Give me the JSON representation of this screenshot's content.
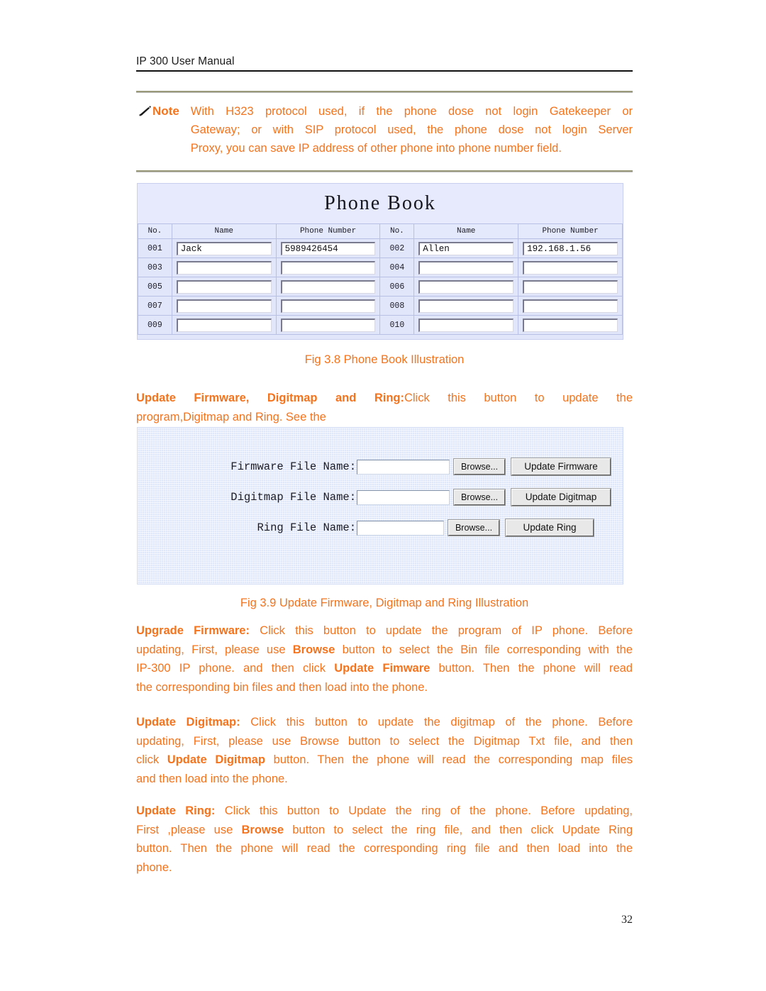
{
  "header": {
    "running_title": "IP 300 User Manual"
  },
  "note": {
    "icon": "pencil-icon",
    "label": "Note",
    "line1": "With H323 protocol used, if the phone dose not login Gatekeeper or",
    "line2": "Gateway; or with SIP protocol used, the phone dose not login Server",
    "line3": "Proxy, you can save IP address of other phone into phone number field.",
    "color": "#f4731c"
  },
  "phone_book": {
    "title": "Phone Book",
    "columns": [
      "No.",
      "Name",
      "Phone Number",
      "No.",
      "Name",
      "Phone Number"
    ],
    "rows": [
      {
        "no_left": "001",
        "name_left": "Jack",
        "phone_left": "5989426454",
        "no_right": "002",
        "name_right": "Allen",
        "phone_right": "192.168.1.56"
      },
      {
        "no_left": "003",
        "name_left": "",
        "phone_left": "",
        "no_right": "004",
        "name_right": "",
        "phone_right": ""
      },
      {
        "no_left": "005",
        "name_left": "",
        "phone_left": "",
        "no_right": "006",
        "name_right": "",
        "phone_right": ""
      },
      {
        "no_left": "007",
        "name_left": "",
        "phone_left": "",
        "no_right": "008",
        "name_right": "",
        "phone_right": ""
      },
      {
        "no_left": "009",
        "name_left": "",
        "phone_left": "",
        "no_right": "010",
        "name_right": "",
        "phone_right": ""
      }
    ],
    "background": "#e2e6fb"
  },
  "caption_38": "Fig 3.8 Phone Book Illustration",
  "caption_39": "Fig 3.9 Update Firmware, Digitmap and Ring Illustration",
  "intro_para": {
    "bold_lead": "Update Firmware, Digitmap and Ring:",
    "line1_rest": "Click this button to update the",
    "line2": "program,Digitmap and Ring. See the"
  },
  "firmware_panel": {
    "rows": [
      {
        "label": "Firmware File Name:",
        "value": "",
        "browse_label": "Browse...",
        "action_label": "Update Firmware"
      },
      {
        "label": "Digitmap File Name:",
        "value": "",
        "browse_label": "Browse...",
        "action_label": "Update Digitmap"
      },
      {
        "label": "Ring File Name:",
        "value": "",
        "browse_label": "Browse...",
        "action_label": "Update Ring"
      }
    ]
  },
  "para_upgrade_firmware": {
    "b1": "Upgrade Firmware:",
    "t1": " Click this button to update the program of IP phone. Before",
    "t2a": "updating, First, please use ",
    "b2": "Browse",
    "t2b": " button to select the Bin file corresponding with the",
    "t3a": "IP-300 IP phone. and then click ",
    "b3": "Update Fimware",
    "t3b": " button. Then the phone will read",
    "t4": "the corresponding bin files and then load into the phone."
  },
  "para_update_digitmap": {
    "b1": "Update Digitmap:",
    "t1": " Click this button to update the digitmap of the phone. Before",
    "t2": "updating, First, please use Browse button to select the Digitmap Txt file, and then",
    "t3a": "click ",
    "b3": "Update Digitmap",
    "t3b": " button. Then the phone will read the corresponding map files",
    "t4": "and then load into the phone."
  },
  "para_update_ring": {
    "b1": "Update Ring:",
    "t1": " Click this button to Update the ring of the phone. Before updating,",
    "t2a": "First ,please use ",
    "b2": "Browse",
    "t2b": " button to select the ring file, and then click Update Ring",
    "t3": "button. Then the phone will read the corresponding ring file and then load into the",
    "t4": "phone."
  },
  "page_number": "32"
}
